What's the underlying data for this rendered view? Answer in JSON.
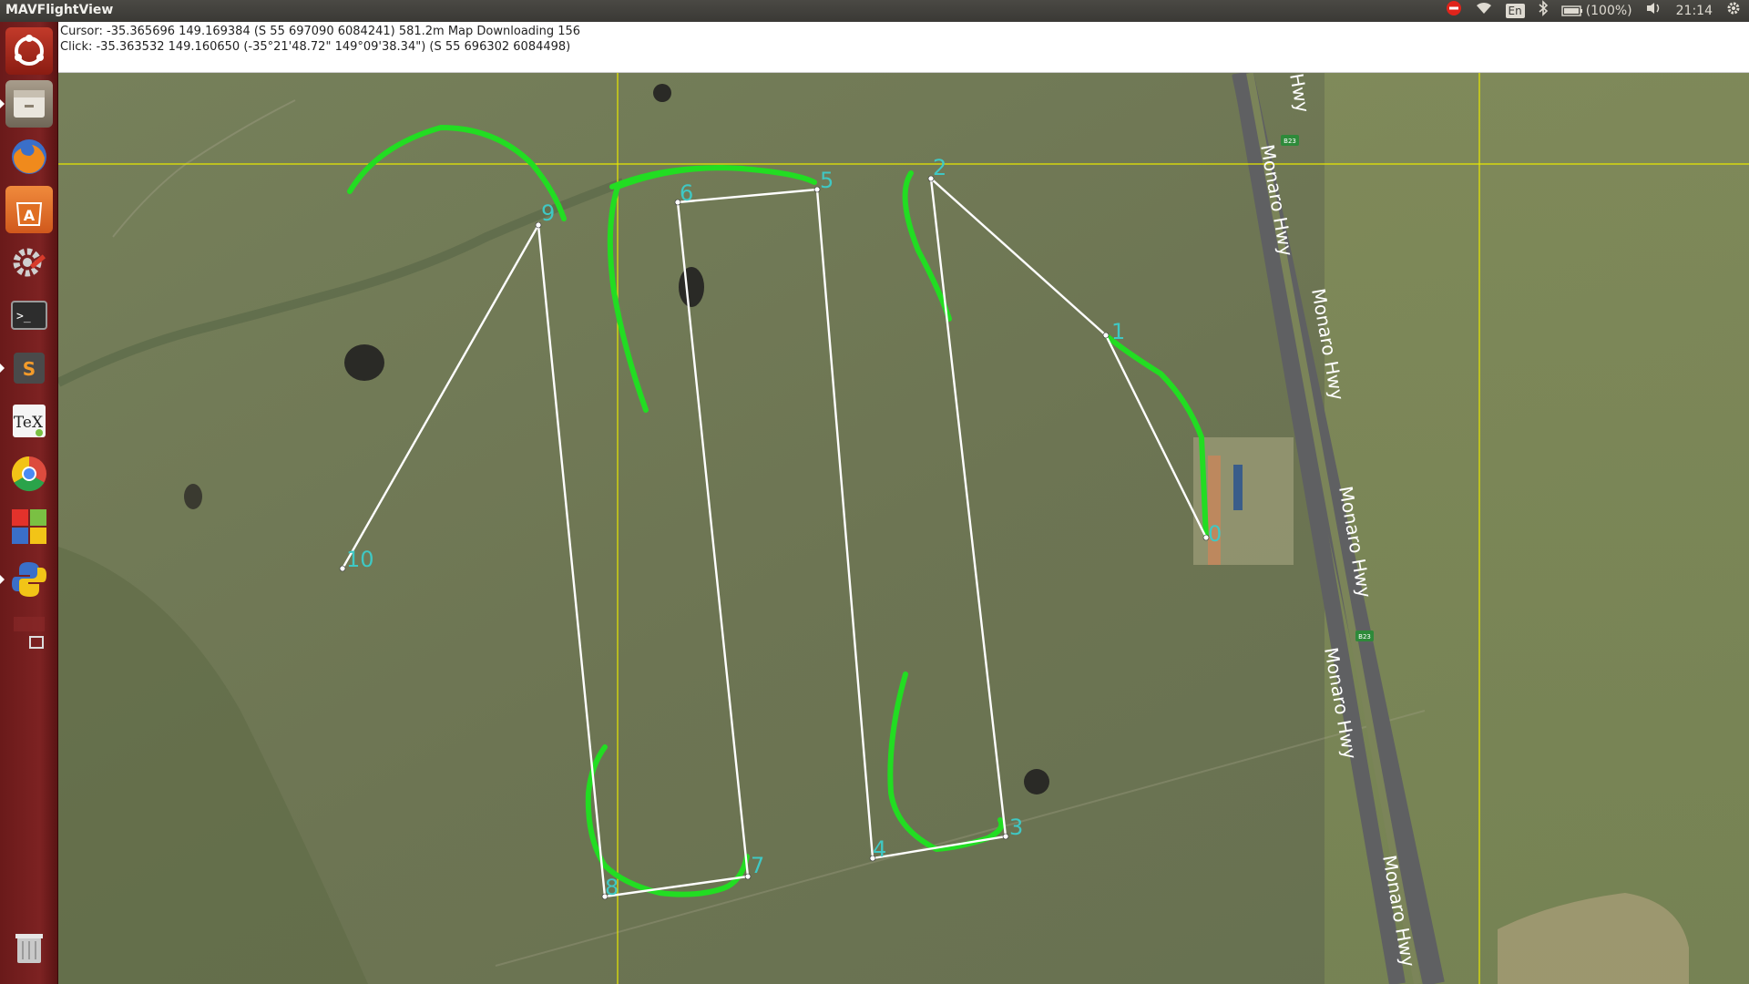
{
  "app": {
    "title": "MAVFlightView"
  },
  "system": {
    "keyboard": "En",
    "battery": "(100%)",
    "clock": "21:14"
  },
  "status": {
    "cursor": "Cursor: -35.365696 149.169384 (S 55 697090 6084241) 581.2m Map Downloading 156",
    "click": "Click: -35.363532 149.160650 (-35°21'48.72\" 149°09'38.34\") (S 55 696302 6084498)"
  },
  "launcher": [
    "ubuntu-dash-icon",
    "files-icon",
    "firefox-icon",
    "software-center-icon",
    "system-settings-icon",
    "terminal-icon",
    "sublime-text-icon",
    "texmaker-icon",
    "chrome-icon",
    "workspace-switcher-icon",
    "python-icon",
    "window-icon",
    "trash-icon"
  ],
  "map": {
    "waypoints": [
      "0",
      "1",
      "2",
      "3",
      "4",
      "5",
      "6",
      "7",
      "8",
      "9",
      "10"
    ],
    "road_labels": [
      "Monaro Hwy",
      "Monaro Hwy",
      "Monaro Hwy",
      "Monaro Hwy",
      "Monaro Hwy",
      "Hwy"
    ],
    "shield_labels": [
      "B23",
      "B23"
    ],
    "colors": {
      "track": "#22dd22",
      "route": "#ffffff",
      "grid": "#e8e800",
      "label": "#3fc8c4"
    }
  }
}
